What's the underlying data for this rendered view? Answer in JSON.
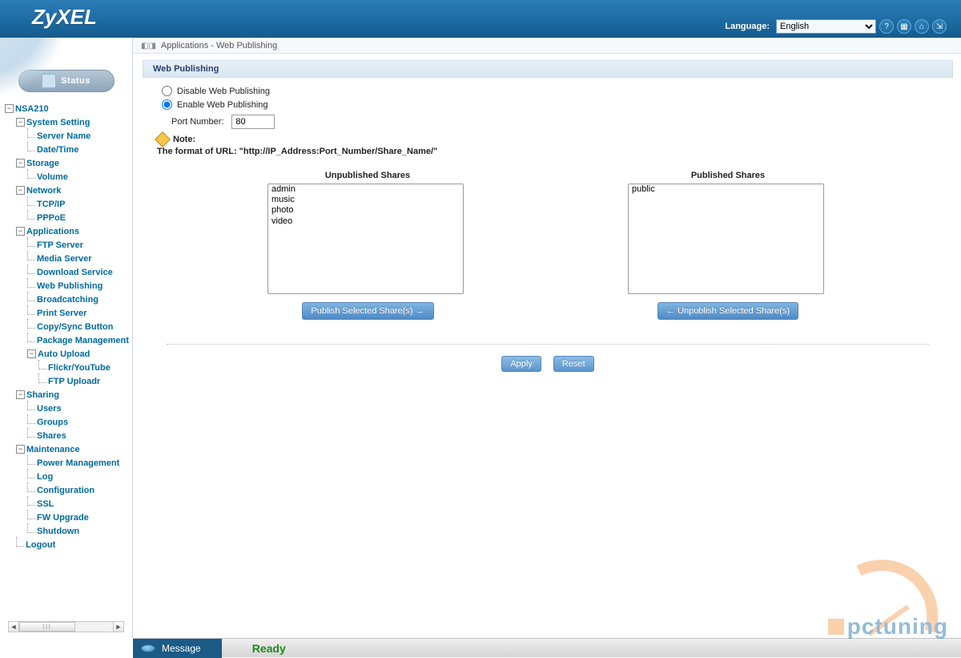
{
  "brand": "ZyXEL",
  "header": {
    "language_label": "Language:",
    "language_value": "English",
    "icons": [
      "help",
      "save",
      "home",
      "logout"
    ]
  },
  "sidebar": {
    "status_label": "Status",
    "root": "NSA210",
    "groups": [
      {
        "label": "System Setting",
        "items": [
          "Server Name",
          "Date/Time"
        ]
      },
      {
        "label": "Storage",
        "items": [
          "Volume"
        ]
      },
      {
        "label": "Network",
        "items": [
          "TCP/IP",
          "PPPoE"
        ]
      },
      {
        "label": "Applications",
        "items": [
          "FTP Server",
          "Media Server",
          "Download Service",
          "Web Publishing",
          "Broadcatching",
          "Print Server",
          "Copy/Sync Button",
          "Package Management"
        ],
        "subgroups": [
          {
            "label": "Auto Upload",
            "items": [
              "Flickr/YouTube",
              "FTP Uploadr"
            ]
          }
        ]
      },
      {
        "label": "Sharing",
        "items": [
          "Users",
          "Groups",
          "Shares"
        ]
      },
      {
        "label": "Maintenance",
        "items": [
          "Power Management",
          "Log",
          "Configuration",
          "SSL",
          "FW Upgrade",
          "Shutdown"
        ]
      }
    ],
    "logout": "Logout"
  },
  "breadcrumb": "Applications - Web Publishing",
  "panel": {
    "title": "Web Publishing",
    "radio_disable": "Disable Web Publishing",
    "radio_enable": "Enable Web Publishing",
    "selected_radio": "enable",
    "port_label": "Port Number:",
    "port_value": "80",
    "note_label": "Note:",
    "note_text": "The format of URL: \"http://IP_Address:Port_Number/Share_Name/\"",
    "unpublished_title": "Unpublished Shares",
    "published_title": "Published Shares",
    "unpublished": [
      "admin",
      "music",
      "photo",
      "video"
    ],
    "published": [
      "public"
    ],
    "publish_btn": "Publish Selected Share(s) →",
    "unpublish_btn": "← Unpublish Selected Share(s)",
    "apply_btn": "Apply",
    "reset_btn": "Reset"
  },
  "statusbar": {
    "message_label": "Message",
    "state": "Ready"
  },
  "watermark": "pctuning"
}
